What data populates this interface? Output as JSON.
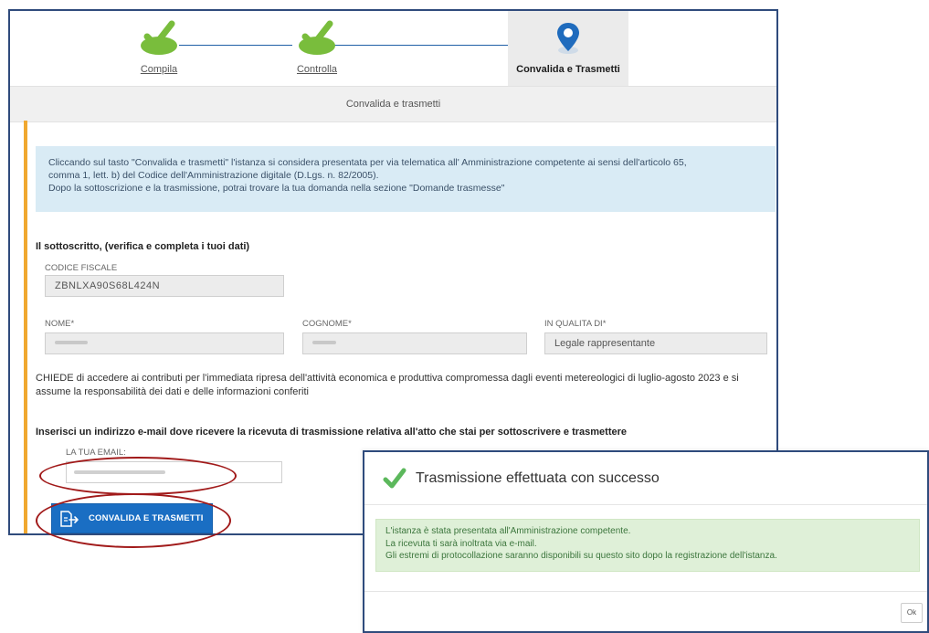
{
  "stepper": {
    "steps": [
      {
        "label": "Compila",
        "state": "done"
      },
      {
        "label": "Controlla",
        "state": "done"
      },
      {
        "label": "Convalida e Trasmetti",
        "state": "current"
      }
    ],
    "done_icon": "checkmark-icon",
    "current_icon": "location-pin-icon",
    "done_color": "#79bd3c",
    "current_color": "#1f6bbd"
  },
  "section": {
    "title": "Convalida e trasmetti"
  },
  "info": {
    "lines": [
      "Cliccando sul tasto \"Convalida e trasmetti\" l'istanza si considera presentata per via telematica all' Amministrazione competente ai sensi dell'articolo 65,",
      "comma 1, lett. b) del Codice dell'Amministrazione digitale (D.Lgs. n. 82/2005).",
      "Dopo la sottoscrizione e la trasmissione, potrai trovare la tua domanda nella sezione \"Domande trasmesse\""
    ]
  },
  "form": {
    "heading": "Il sottoscritto, (verifica e completa i tuoi dati)",
    "codice_fiscale": {
      "label": "CODICE FISCALE",
      "value": "ZBNLXA90S68L424N"
    },
    "nome": {
      "label": "NOME*"
    },
    "cognome": {
      "label": "COGNOME*"
    },
    "qualita": {
      "label": "IN QUALITA DI*",
      "value": "Legale rappresentante"
    },
    "chiede": "CHIEDE di accedere ai contributi per l'immediata ripresa dell'attività economica e produttiva compromessa dagli eventi metereologici di luglio-agosto 2023 e si assume la responsabilità dei dati e delle informazioni conferiti",
    "email_heading": "Inserisci un indirizzo e-mail dove ricevere la ricevuta di trasmissione relativa all'atto che stai per sottoscrivere e trasmettere",
    "email_label": "LA TUA EMAIL:",
    "submit_label": "CONVALIDA E TRASMETTI"
  },
  "highlight_color": "#a11a1a",
  "dialog": {
    "title": "Trasmissione effettuata con successo",
    "lines": [
      "L'istanza è stata presentata all'Amministrazione competente.",
      "La ricevuta ti sarà inoltrata via e-mail.",
      "Gli estremi di protocollazione saranno disponibili su questo sito dopo la registrazione dell'istanza."
    ],
    "ok_label": "Ok"
  }
}
